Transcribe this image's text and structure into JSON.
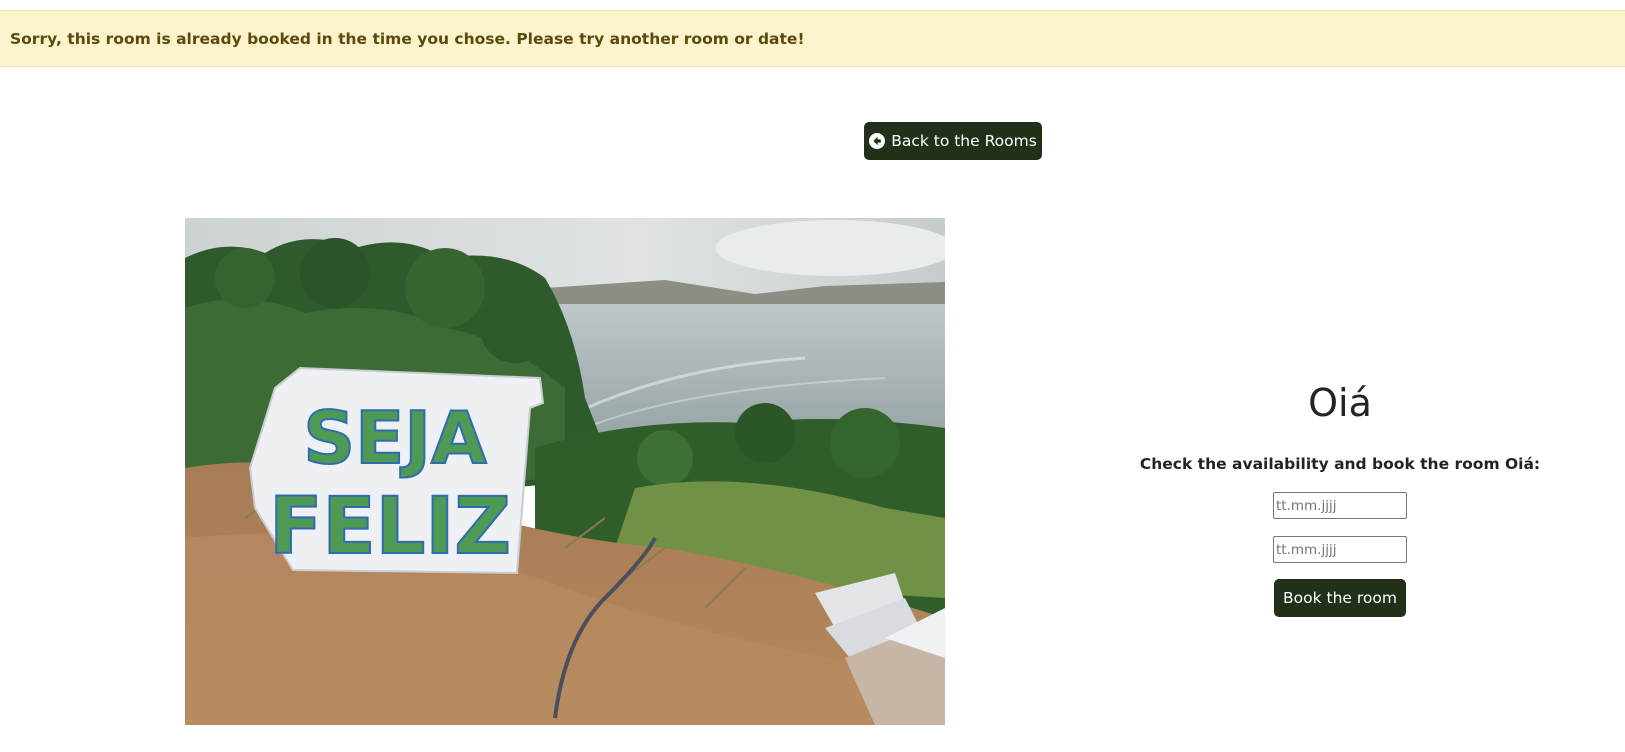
{
  "alert": {
    "message": "Sorry, this room is already booked in the time you chose. Please try another room or date!"
  },
  "nav": {
    "back_label": "Back to the Rooms",
    "back_icon": "arrow-circle-left-icon"
  },
  "room": {
    "name": "Oiá",
    "photo_sign_text": [
      "SEJA",
      "FELIZ"
    ]
  },
  "booking": {
    "prompt": "Check the availability and book the room Oiá:",
    "start_date": {
      "value": "",
      "placeholder": "tt.mm.jjjj"
    },
    "end_date": {
      "value": "",
      "placeholder": "tt.mm.jjjj"
    },
    "submit_label": "Book the room"
  },
  "colors": {
    "alert_bg": "#fdf3cd",
    "alert_text": "#5c4a0d",
    "button_bg": "#223019",
    "button_text": "#ffffff"
  }
}
